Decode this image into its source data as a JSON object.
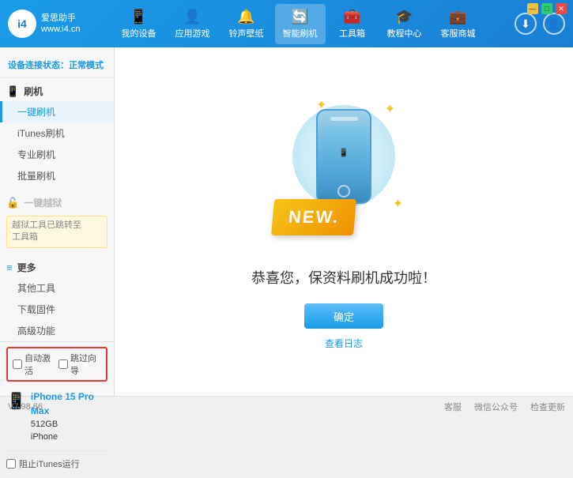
{
  "app": {
    "title": "爱思助手",
    "subtitle": "www.i4.cn"
  },
  "window_controls": {
    "minimize": "—",
    "maximize": "□",
    "close": "✕"
  },
  "nav": {
    "tabs": [
      {
        "id": "my-device",
        "icon": "📱",
        "label": "我的设备"
      },
      {
        "id": "apps-games",
        "icon": "👤",
        "label": "应用游戏"
      },
      {
        "id": "ringtones",
        "icon": "🔔",
        "label": "铃声壁纸"
      },
      {
        "id": "smart-flash",
        "icon": "🔄",
        "label": "智能刷机",
        "active": true
      },
      {
        "id": "toolbox",
        "icon": "🧰",
        "label": "工具箱"
      },
      {
        "id": "tutorial",
        "icon": "🎓",
        "label": "教程中心"
      },
      {
        "id": "service",
        "icon": "💼",
        "label": "客服商城"
      }
    ]
  },
  "sidebar": {
    "status_label": "设备连接状态：",
    "status_value": "正常模式",
    "sections": [
      {
        "id": "flash",
        "icon": "📱",
        "label": "刷机",
        "items": [
          {
            "id": "one-key-flash",
            "label": "一键刷机",
            "active": true
          },
          {
            "id": "itunes-flash",
            "label": "iTunes刷机"
          },
          {
            "id": "pro-flash",
            "label": "专业刷机"
          },
          {
            "id": "batch-flash",
            "label": "批量刷机"
          }
        ]
      },
      {
        "id": "jailbreak",
        "icon": "🔓",
        "label": "一键越狱",
        "disabled": true
      }
    ],
    "notice": "越狱工具已跳转至\n工具箱",
    "more_section": {
      "label": "更多",
      "items": [
        {
          "id": "other-tools",
          "label": "其他工具"
        },
        {
          "id": "download-firmware",
          "label": "下载固件"
        },
        {
          "id": "advanced",
          "label": "高级功能"
        }
      ]
    },
    "auto_options": {
      "auto_activate": "自动激活",
      "skip_guide": "跳过向导"
    },
    "device": {
      "name": "iPhone 15 Pro Max",
      "storage": "512GB",
      "type": "iPhone"
    },
    "itunes_label": "阻止iTunes运行"
  },
  "main": {
    "new_badge": "NEW.",
    "success_message": "恭喜您，保资料刷机成功啦！",
    "confirm_button": "确定",
    "log_link": "查看日志"
  },
  "footer": {
    "version": "V7.98.66",
    "links": [
      "客服",
      "微信公众号",
      "检查更新"
    ]
  }
}
